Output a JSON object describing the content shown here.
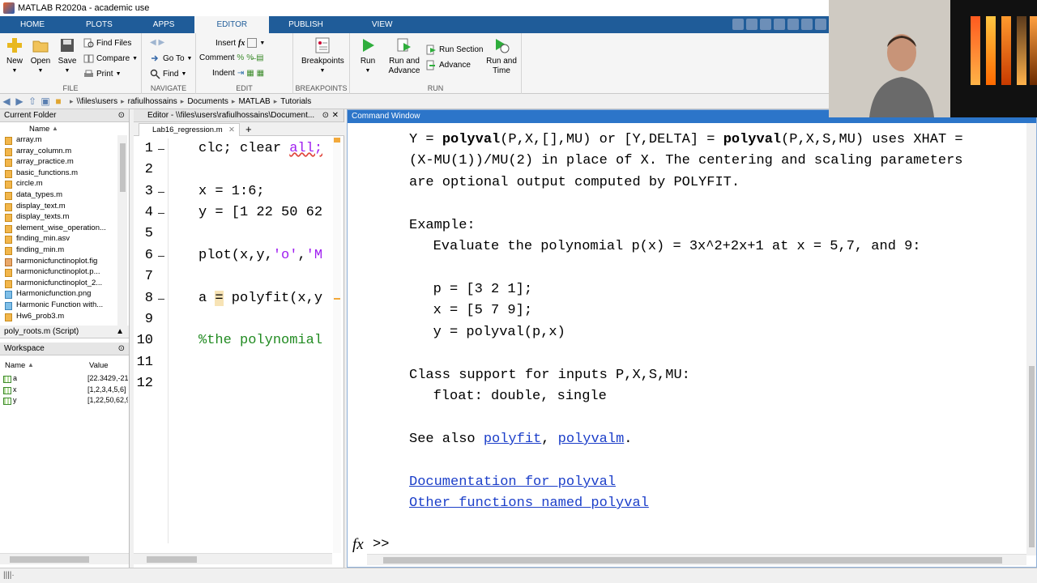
{
  "window": {
    "title": "MATLAB R2020a - academic use"
  },
  "ribbon": {
    "tabs": [
      "HOME",
      "PLOTS",
      "APPS",
      "EDITOR",
      "PUBLISH",
      "VIEW"
    ],
    "active_tab": "EDITOR",
    "file": {
      "label": "FILE",
      "new": "New",
      "open": "Open",
      "save": "Save",
      "find_files": "Find Files",
      "compare": "Compare",
      "print": "Print"
    },
    "navigate": {
      "label": "NAVIGATE",
      "go_to": "Go To",
      "find": "Find"
    },
    "edit": {
      "label": "EDIT",
      "insert": "Insert",
      "comment": "Comment",
      "indent": "Indent",
      "fx": "fx"
    },
    "breakpoints": {
      "label": "BREAKPOINTS",
      "breakpoints": "Breakpoints"
    },
    "run": {
      "label": "RUN",
      "run": "Run",
      "run_advance_1": "Run and",
      "run_advance_2": "Advance",
      "run_section": "Run Section",
      "advance": "Advance",
      "run_time_1": "Run and",
      "run_time_2": "Time"
    }
  },
  "address": {
    "path": [
      "\\\\files\\users",
      "rafiulhossains",
      "Documents",
      "MATLAB",
      "Tutorials"
    ]
  },
  "current_folder": {
    "title": "Current Folder",
    "col_name": "Name",
    "files": [
      {
        "name": "array.m",
        "type": "m"
      },
      {
        "name": "array_column.m",
        "type": "m"
      },
      {
        "name": "array_practice.m",
        "type": "m"
      },
      {
        "name": "basic_functions.m",
        "type": "m"
      },
      {
        "name": "circle.m",
        "type": "m"
      },
      {
        "name": "data_types.m",
        "type": "m"
      },
      {
        "name": "display_text.m",
        "type": "m"
      },
      {
        "name": "display_texts.m",
        "type": "m"
      },
      {
        "name": "element_wise_operation...",
        "type": "m"
      },
      {
        "name": "finding_min.asv",
        "type": "m"
      },
      {
        "name": "finding_min.m",
        "type": "m"
      },
      {
        "name": "harmonicfunctinoplot.fig",
        "type": "fig"
      },
      {
        "name": "harmonicfunctinoplot.p...",
        "type": "m"
      },
      {
        "name": "harmonicfunctinoplot_2...",
        "type": "m"
      },
      {
        "name": "Harmonicfunction.png",
        "type": "img"
      },
      {
        "name": "Harmonic Function with...",
        "type": "img"
      },
      {
        "name": "Hw6_prob3.m",
        "type": "m"
      }
    ],
    "details": "poly_roots.m  (Script)"
  },
  "workspace": {
    "title": "Workspace",
    "col_name": "Name",
    "col_value": "Value",
    "vars": [
      {
        "name": "a",
        "value": "[22.3429,-21"
      },
      {
        "name": "x",
        "value": "[1,2,3,4,5,6]"
      },
      {
        "name": "y",
        "value": "[1,22,50,62,9"
      }
    ]
  },
  "editor": {
    "header": "Editor - \\\\files\\users\\rafiulhossains\\Document...",
    "tab": "Lab16_regression.m",
    "add_tab": "+",
    "lines": [
      {
        "n": "1",
        "dash": true
      },
      {
        "n": "2",
        "dash": false
      },
      {
        "n": "3",
        "dash": true
      },
      {
        "n": "4",
        "dash": true
      },
      {
        "n": "5",
        "dash": false
      },
      {
        "n": "6",
        "dash": true
      },
      {
        "n": "7",
        "dash": false
      },
      {
        "n": "8",
        "dash": true
      },
      {
        "n": "9",
        "dash": false
      },
      {
        "n": "10",
        "dash": false
      },
      {
        "n": "11",
        "dash": false
      },
      {
        "n": "12",
        "dash": false
      }
    ],
    "code": {
      "l1a": "clc; clear ",
      "l1b": "all;",
      "l3": "x = 1:6;",
      "l4": "y = [1 22 50 62",
      "l6a": "plot(x,y,",
      "l6b": "'o'",
      "l6c": ",",
      "l6d": "'M",
      "l8a": "a ",
      "l8b": "=",
      "l8c": " polyfit(x,y",
      "l10": "%the polynomial"
    }
  },
  "command_window": {
    "title": "Command Window",
    "t1a": "Y = ",
    "t1b": "polyval",
    "t1c": "(P,X,[],MU) or [Y,DELTA] = ",
    "t1d": "polyval",
    "t1e": "(P,X,S,MU) uses XHAT =",
    "t2": "(X-MU(1))/MU(2) in place of X. The centering and scaling parameters",
    "t3": "are optional output computed by POLYFIT.",
    "t5": "Example:",
    "t6": "   Evaluate the polynomial p(x) = 3x^2+2x+1 at x = 5,7, and 9:",
    "t8": "   p = [3 2 1];",
    "t9": "   x = [5 7 9];",
    "t10": "   y = polyval(p,x)",
    "t12": "Class support for inputs P,X,S,MU:",
    "t13": "   float: double, single",
    "t15a": "See also ",
    "t15b": "polyfit",
    "t15c": ", ",
    "t15d": "polyvalm",
    "t15e": ".",
    "t17": "Documentation for polyval",
    "t18": "Other functions named polyval",
    "prompt_fx": "fx",
    "prompt": ">>"
  },
  "colors": {
    "ribbon": "#1f5c99",
    "cmd_header": "#2c75c9",
    "link": "#1b3ec9",
    "string": "#a020f0",
    "comment": "#228b22"
  }
}
